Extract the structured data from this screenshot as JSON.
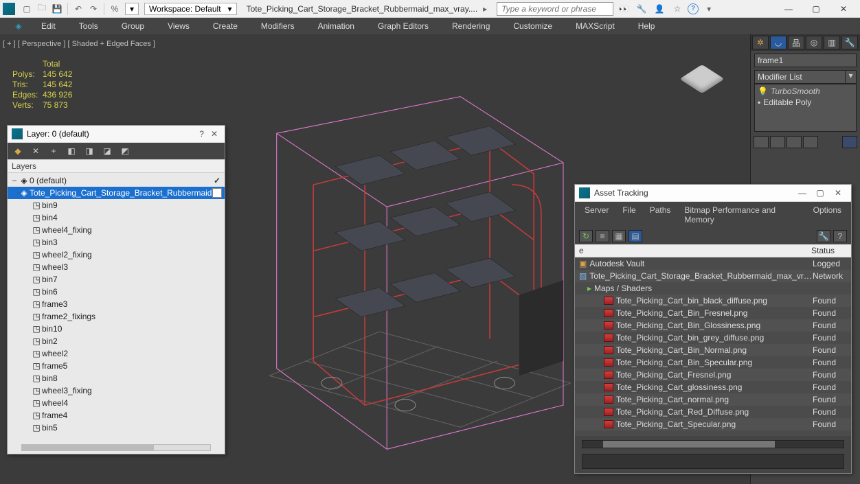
{
  "titlebar": {
    "workspace_label": "Workspace: Default",
    "doc_title": "Tote_Picking_Cart_Storage_Bracket_Rubbermaid_max_vray....",
    "search_placeholder": "Type a keyword or phrase"
  },
  "menubar": {
    "edit": "Edit",
    "tools": "Tools",
    "group": "Group",
    "views": "Views",
    "create": "Create",
    "modifiers": "Modifiers",
    "animation": "Animation",
    "graph_editors": "Graph Editors",
    "rendering": "Rendering",
    "customize": "Customize",
    "maxscript": "MAXScript",
    "help": "Help"
  },
  "viewport": {
    "label": "[ + ] [ Perspective ] [ Shaded + Edged Faces ]",
    "stats_title": "Total",
    "polys_label": "Polys:",
    "polys": "145 642",
    "tris_label": "Tris:",
    "tris": "145 642",
    "edges_label": "Edges:",
    "edges": "436 926",
    "verts_label": "Verts:",
    "verts": "75 873"
  },
  "right_panel": {
    "name_field": "frame1",
    "modlist_label": "Modifier List",
    "mods": {
      "m0": "TurboSmooth",
      "m1": "Editable Poly"
    }
  },
  "layer_dialog": {
    "title": "Layer: 0 (default)",
    "header": "Layers",
    "root": "0 (default)",
    "selected": "Tote_Picking_Cart_Storage_Bracket_Rubbermaid",
    "items": [
      "bin9",
      "bin4",
      "wheel4_fixing",
      "bin3",
      "wheel2_fixing",
      "wheel3",
      "bin7",
      "bin6",
      "frame3",
      "frame2_fixings",
      "bin10",
      "bin2",
      "wheel2",
      "frame5",
      "bin8",
      "wheel3_fixing",
      "wheel4",
      "frame4",
      "bin5"
    ]
  },
  "asset_dialog": {
    "title": "Asset Tracking",
    "menu": {
      "server": "Server",
      "file": "File",
      "paths": "Paths",
      "bitmap": "Bitmap Performance and Memory",
      "options": "Options"
    },
    "col_name": "e",
    "col_status": "Status",
    "vault_label": "Autodesk Vault",
    "vault_status": "Logged",
    "scene_file": "Tote_Picking_Cart_Storage_Bracket_Rubbermaid_max_vray.max",
    "scene_status": "Network",
    "group_label": "Maps / Shaders",
    "maps": [
      {
        "name": "Tote_Picking_Cart_bin_black_diffuse.png",
        "status": "Found"
      },
      {
        "name": "Tote_Picking_Cart_Bin_Fresnel.png",
        "status": "Found"
      },
      {
        "name": "Tote_Picking_Cart_Bin_Glossiness.png",
        "status": "Found"
      },
      {
        "name": "Tote_Picking_Cart_bin_grey_diffuse.png",
        "status": "Found"
      },
      {
        "name": "Tote_Picking_Cart_Bin_Normal.png",
        "status": "Found"
      },
      {
        "name": "Tote_Picking_Cart_Bin_Specular.png",
        "status": "Found"
      },
      {
        "name": "Tote_Picking_Cart_Fresnel.png",
        "status": "Found"
      },
      {
        "name": "Tote_Picking_Cart_glossiness.png",
        "status": "Found"
      },
      {
        "name": "Tote_Picking_Cart_normal.png",
        "status": "Found"
      },
      {
        "name": "Tote_Picking_Cart_Red_Diffuse.png",
        "status": "Found"
      },
      {
        "name": "Tote_Picking_Cart_Specular.png",
        "status": "Found"
      }
    ]
  }
}
